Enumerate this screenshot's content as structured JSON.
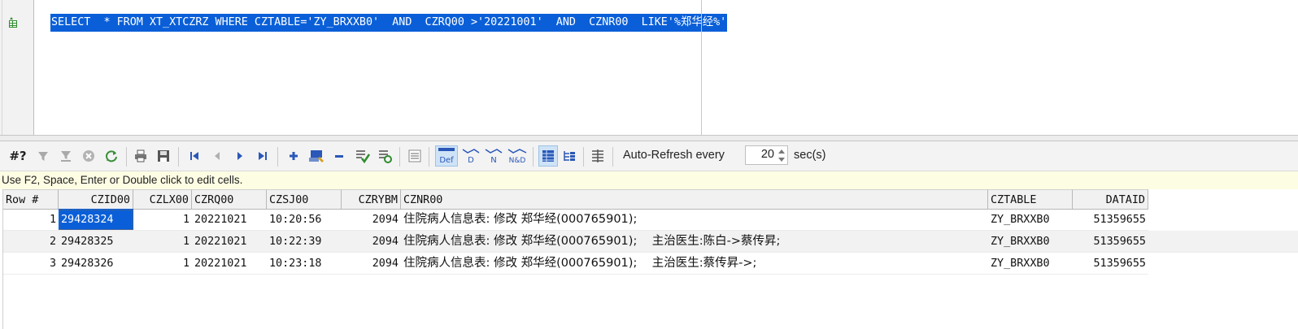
{
  "editor": {
    "sql": "SELECT  * FROM XT_XTCZRZ WHERE CZTABLE='ZY_BRXXB0'  AND  CZRQ00 >'20221001'  AND  CZNR00  LIKE'%郑华经%'"
  },
  "toolbar": {
    "row_count_label": "#?",
    "auto_refresh_label": "Auto-Refresh every",
    "refresh_value": "20",
    "refresh_unit": "sec(s)",
    "icons": [
      "row-count-icon",
      "filter-icon",
      "filter-clear-icon",
      "cancel-icon",
      "refresh-icon",
      "print-icon",
      "save-icon",
      "first-record-icon",
      "prior-record-icon",
      "next-record-icon",
      "last-record-icon",
      "insert-record-icon",
      "edit-record-icon",
      "delete-record-icon",
      "post-icon",
      "refresh-record-icon",
      "clear-icon",
      "default-view-icon",
      "d-view-icon",
      "n-view-icon",
      "nd-view-icon",
      "grid-view-icon",
      "tree-view-icon",
      "layout-icon"
    ],
    "accent": "#0a5fd8"
  },
  "hint": "Use F2, Space, Enter or Double click to edit cells.",
  "grid": {
    "columns": [
      "Row #",
      "CZID00",
      "CZLX00",
      "CZRQ00",
      "CZSJ00",
      "CZRYBM",
      "CZNR00",
      "CZTABLE",
      "DATAID"
    ],
    "rows": [
      {
        "row": "1",
        "czid": "29428324",
        "czlx": "1",
        "czrq": "20221021",
        "czsj": "10:20:56",
        "czrybm": "2094",
        "cznr": "住院病人信息表: 修改 郑华经(000765901);",
        "cztable": "ZY_BRXXB0",
        "dataid": "51359655"
      },
      {
        "row": "2",
        "czid": "29428325",
        "czlx": "1",
        "czrq": "20221021",
        "czsj": "10:22:39",
        "czrybm": "2094",
        "cznr": "住院病人信息表: 修改 郑华经(000765901);    主治医生:陈白->蔡传昇;",
        "cztable": "ZY_BRXXB0",
        "dataid": "51359655"
      },
      {
        "row": "3",
        "czid": "29428326",
        "czlx": "1",
        "czrq": "20221021",
        "czsj": "10:23:18",
        "czrybm": "2094",
        "cznr": "住院病人信息表: 修改 郑华经(000765901);    主治医生:蔡传昇->;",
        "cztable": "ZY_BRXXB0",
        "dataid": "51359655"
      }
    ],
    "selected_cell_color": "#0a5fd8"
  }
}
